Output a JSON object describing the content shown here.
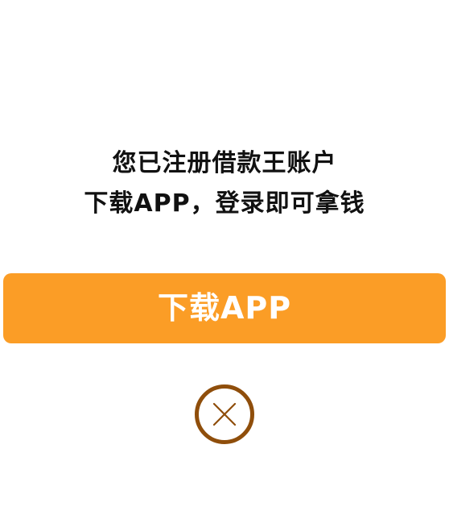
{
  "dialog": {
    "message_line1": "您已注册借款王账户",
    "message_line2": "下载APP，登录即可拿钱",
    "download_label": "下载APP",
    "close_icon": "close-circle-icon",
    "colors": {
      "button_bg": "#fb9d26",
      "button_text": "#ffffff",
      "close_icon": "#8f4e0b",
      "message_text": "#111111"
    }
  }
}
